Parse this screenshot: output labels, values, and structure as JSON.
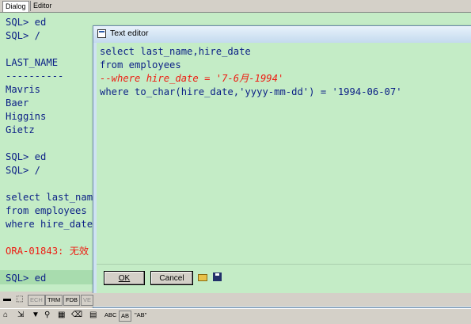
{
  "tabs": {
    "dialog": "Dialog",
    "editor": "Editor"
  },
  "console": {
    "lines": [
      {
        "text": "SQL> ed",
        "style": "code"
      },
      {
        "text": "SQL> /",
        "style": "code"
      },
      {
        "text": "",
        "style": "code"
      },
      {
        "text": "LAST_NAME",
        "style": "code"
      },
      {
        "text": "----------",
        "style": "code"
      },
      {
        "text": "Mavris",
        "style": "code"
      },
      {
        "text": "Baer",
        "style": "code"
      },
      {
        "text": "Higgins",
        "style": "code"
      },
      {
        "text": "Gietz",
        "style": "code"
      },
      {
        "text": "",
        "style": "code"
      },
      {
        "text": "SQL> ed",
        "style": "code"
      },
      {
        "text": "SQL> /",
        "style": "code"
      },
      {
        "text": "",
        "style": "code"
      },
      {
        "text": "select last_nam",
        "style": "code"
      },
      {
        "text": "from employees",
        "style": "code"
      },
      {
        "text": "where hire_date",
        "style": "code"
      },
      {
        "text": "",
        "style": "code"
      },
      {
        "text": "ORA-01843: 无效",
        "style": "err"
      },
      {
        "text": "",
        "style": "code"
      },
      {
        "text": "SQL> ed",
        "style": "code"
      }
    ]
  },
  "editor_window": {
    "title": "Text editor",
    "lines": [
      {
        "text": "select last_name,hire_date",
        "style": "code"
      },
      {
        "text": "from employees",
        "style": "code"
      },
      {
        "text": "--where hire_date = '7-6月-1994'",
        "style": "comment"
      },
      {
        "text": "where to_char(hire_date,'yyyy-mm-dd') = '1994-06-07'",
        "style": "code"
      }
    ],
    "ok_label": "OK",
    "cancel_label": "Cancel",
    "open_icon": "open-folder-icon",
    "save_icon": "floppy-disk-icon"
  },
  "toolbar1": [
    "ECH",
    "TRM",
    "FDB",
    "VE"
  ],
  "toolbar2": [
    "ABC",
    "AB",
    "\"AB\""
  ]
}
